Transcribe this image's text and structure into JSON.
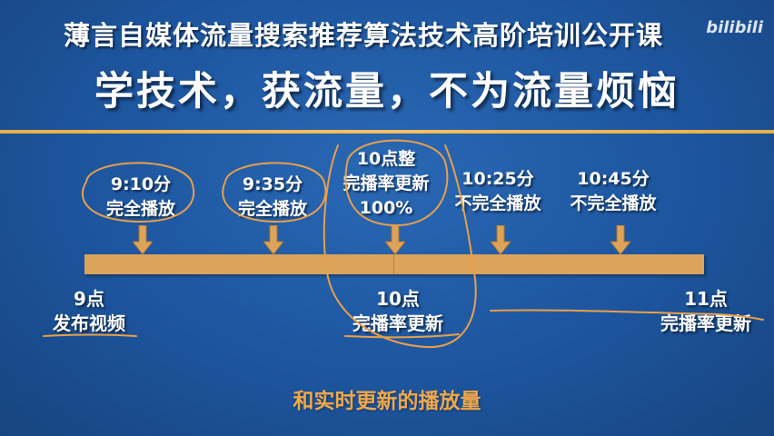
{
  "header": {
    "title": "薄言自媒体流量搜索推荐算法技术高阶培训公开课",
    "slogan": "学技术，获流量，不为流量烦恼",
    "watermark": "bilibili"
  },
  "timeline": {
    "events": [
      {
        "line1": "9:10分",
        "line2": "完全播放"
      },
      {
        "line1": "9:35分",
        "line2": "完全播放"
      },
      {
        "line1": "10点整",
        "line2": "完播率更新",
        "line3": "100%"
      },
      {
        "line1": "10:25分",
        "line2": "不完全播放"
      },
      {
        "line1": "10:45分",
        "line2": "不完全播放"
      }
    ],
    "points": [
      {
        "line1": "9点",
        "line2": "发布视频"
      },
      {
        "line1": "10点",
        "line2": "完播率更新"
      },
      {
        "line1": "11点",
        "line2": "完播率更新"
      }
    ]
  },
  "footer": {
    "highlight": "和实时更新的播放量"
  },
  "colors": {
    "background": "#1f57a0",
    "accent": "#dca35a",
    "highlight": "#f0a84a",
    "ink": "#e8a04a",
    "text": "#ffffff"
  }
}
